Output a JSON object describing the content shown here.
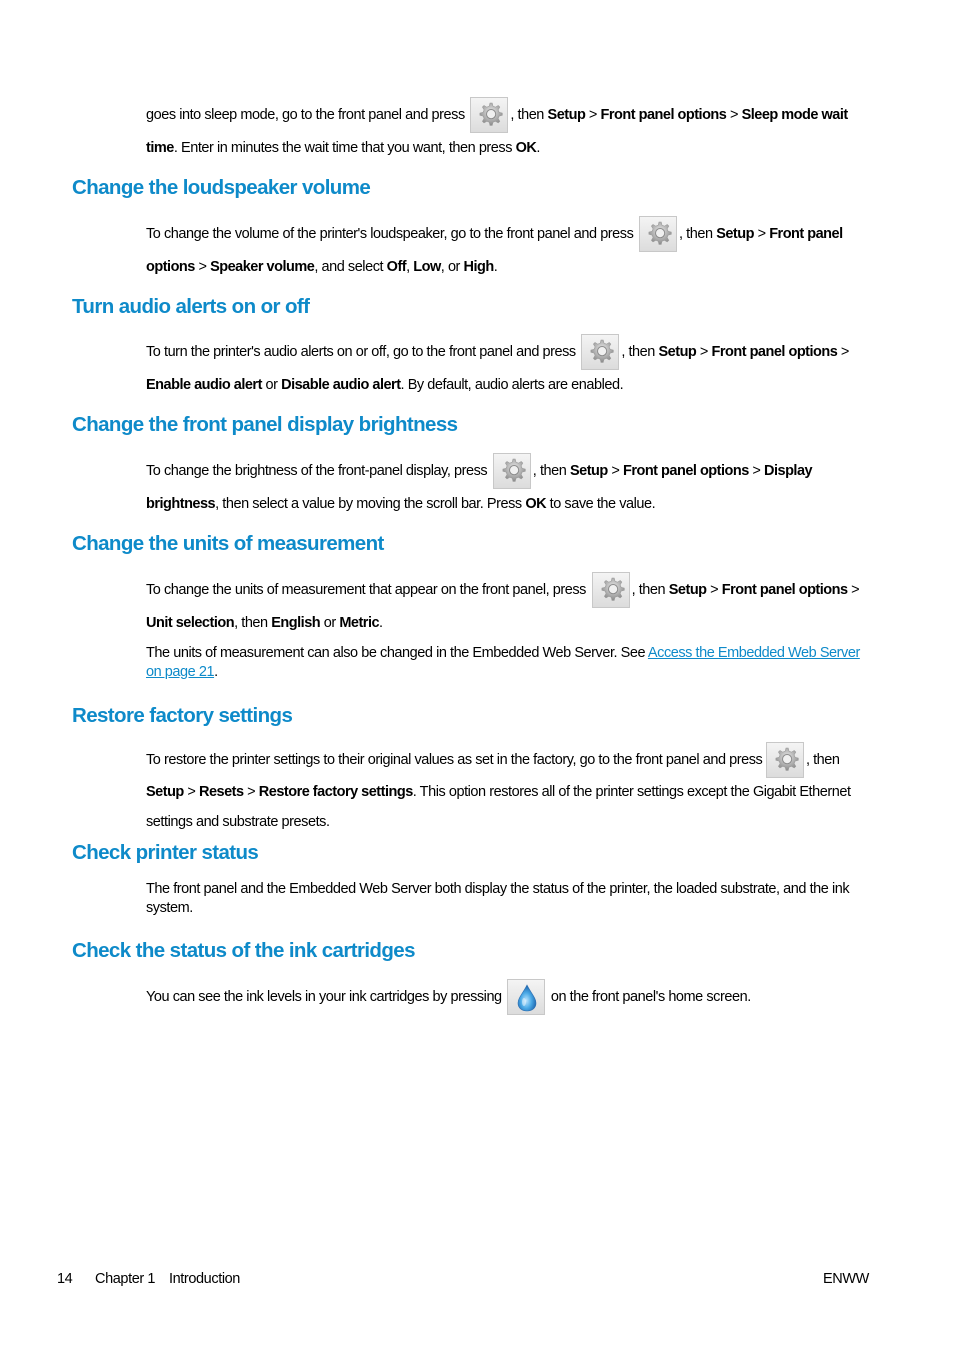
{
  "sleep_para": {
    "t1": "goes into sleep mode, go to the front panel and press",
    "t2": ", then",
    "b1": "Setup",
    "sep": ">",
    "b2": "Front panel options",
    "b3": "Sleep mode wait time",
    "t3": ". Enter in minutes the wait time that you want, then press",
    "b4": "OK",
    "t4": "."
  },
  "sections": [
    {
      "title": "Change the loudspeaker volume",
      "t1": "To change the volume of the printer's loudspeaker, go to the front panel and press",
      "t2": ", then",
      "b1": "Setup",
      "b2": "Front panel options",
      "b3": "Speaker volume",
      "t3": ", and select",
      "b4": "Off",
      "b5": "Low",
      "t4": ", or",
      "b6": "High",
      "t5": "."
    },
    {
      "title": "Turn audio alerts on or off",
      "t1": "To turn the printer's audio alerts on or off, go to the front panel and press",
      "t2": ", then",
      "b1": "Setup",
      "b2": "Front panel options",
      "b3": "Enable audio alert",
      "t3": "or",
      "b4": "Disable audio alert",
      "t4": ". By default, audio alerts are enabled."
    },
    {
      "title": "Change the front panel display brightness",
      "t1": "To change the brightness of the front-panel display, press",
      "t2": ", then",
      "b1": "Setup",
      "b2": "Front panel options",
      "b3": "Display brightness",
      "t3": ", then select a value by moving the scroll bar. Press",
      "b4": "OK",
      "t4": "to save the value."
    },
    {
      "title": "Change the units of measurement",
      "t1": "To change the units of measurement that appear on the front panel, press",
      "t2": ", then",
      "b1": "Setup",
      "b2": "Front panel options",
      "b3": "Unit selection",
      "t3": ", then",
      "b4": "English",
      "t4": "or",
      "b5": "Metric",
      "t5": ".",
      "p2": "The units of measurement can also be changed in the Embedded Web Server. See",
      "link": "Access the Embedded Web Server on page 21",
      "p2end": "."
    },
    {
      "title": "Restore factory settings",
      "t1": "To restore the printer settings to their original values as set in the factory, go to the front panel and press",
      "t2": ", then",
      "b1": "Setup",
      "b2": "Resets",
      "b3": "Restore factory settings",
      "t3": ". This option restores all of the printer settings except the Gigabit Ethernet settings and substrate presets."
    },
    {
      "title": "Check printer status",
      "t1": "The front panel and the Embedded Web Server both display the status of the printer, the loaded substrate, and the ink system."
    },
    {
      "title": "Check the status of the ink cartridges",
      "t1": "You can see the ink levels in your ink cartridges by pressing",
      "t2": "on the front panel's home screen."
    }
  ],
  "icons": {
    "settings": "gear-icon",
    "ink": "ink-drop-icon"
  },
  "footer": {
    "page_number": "14",
    "chapter": "Chapter 1",
    "chapter_title": "Introduction",
    "locale": "ENWW"
  },
  "colors": {
    "heading": "#0e8ac9",
    "link": "#0e8ac9"
  }
}
